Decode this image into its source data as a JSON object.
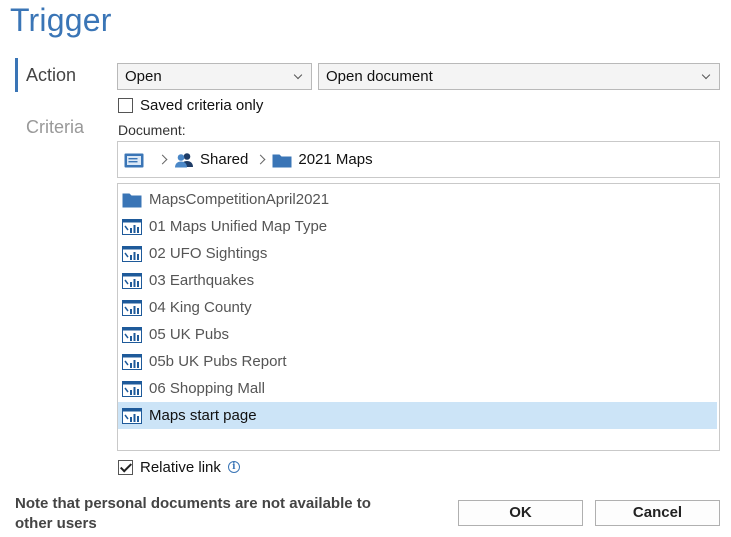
{
  "title": "Trigger",
  "nav": {
    "action": "Action",
    "criteria": "Criteria"
  },
  "action_select": {
    "value": "Open"
  },
  "target_select": {
    "value": "Open document"
  },
  "saved_criteria": {
    "label": "Saved criteria only",
    "checked": false
  },
  "document_label": "Document:",
  "breadcrumb": {
    "root_icon": "library-icon",
    "items": [
      {
        "label": "Shared",
        "icon": "users-icon"
      },
      {
        "label": "2021 Maps",
        "icon": "folder-icon"
      }
    ]
  },
  "documents": [
    {
      "label": "MapsCompetitionApril2021",
      "icon": "folder-icon"
    },
    {
      "label": "01 Maps Unified Map Type",
      "icon": "chart-document-icon"
    },
    {
      "label": "02 UFO Sightings",
      "icon": "chart-document-icon"
    },
    {
      "label": "03 Earthquakes",
      "icon": "chart-document-icon"
    },
    {
      "label": "04 King County",
      "icon": "chart-document-icon"
    },
    {
      "label": "05 UK Pubs",
      "icon": "chart-document-icon"
    },
    {
      "label": "05b UK Pubs Report",
      "icon": "chart-document-icon"
    },
    {
      "label": "06 Shopping Mall",
      "icon": "chart-document-icon"
    },
    {
      "label": "Maps start page",
      "icon": "chart-document-icon",
      "selected": true
    }
  ],
  "relative_link": {
    "label": "Relative link",
    "checked": true
  },
  "note": "Note that personal documents are not available to other users",
  "buttons": {
    "ok": "OK",
    "cancel": "Cancel"
  },
  "colors": {
    "accent": "#3a75b6",
    "selection": "#cce4f7"
  }
}
